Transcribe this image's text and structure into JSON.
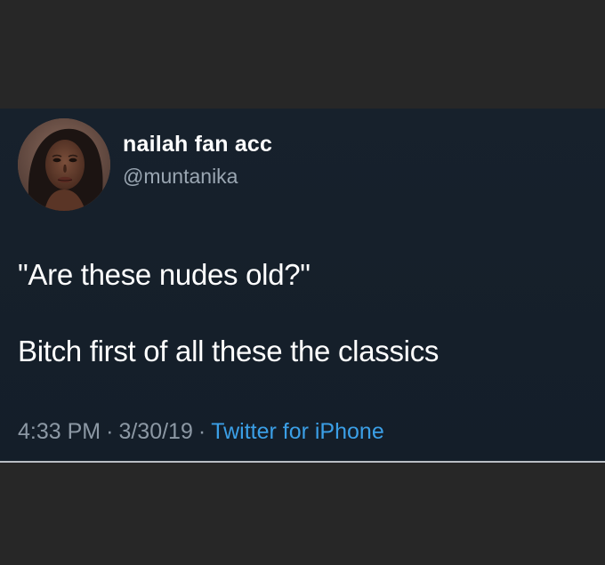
{
  "tweet": {
    "display_name": "nailah fan acc",
    "handle": "@muntanika",
    "lines": [
      "\"Are these nudes old?\"",
      "Bitch first of all these the classics"
    ],
    "time": "4:33 PM",
    "separator": "·",
    "date": "3/30/19",
    "source": "Twitter for iPhone",
    "avatar_icon": "profile-photo"
  },
  "colors": {
    "outer_background": "#272727",
    "card_background": "#15202b",
    "text_primary": "#ffffff",
    "text_secondary": "#8c98a4",
    "link": "#3b9fe6"
  }
}
